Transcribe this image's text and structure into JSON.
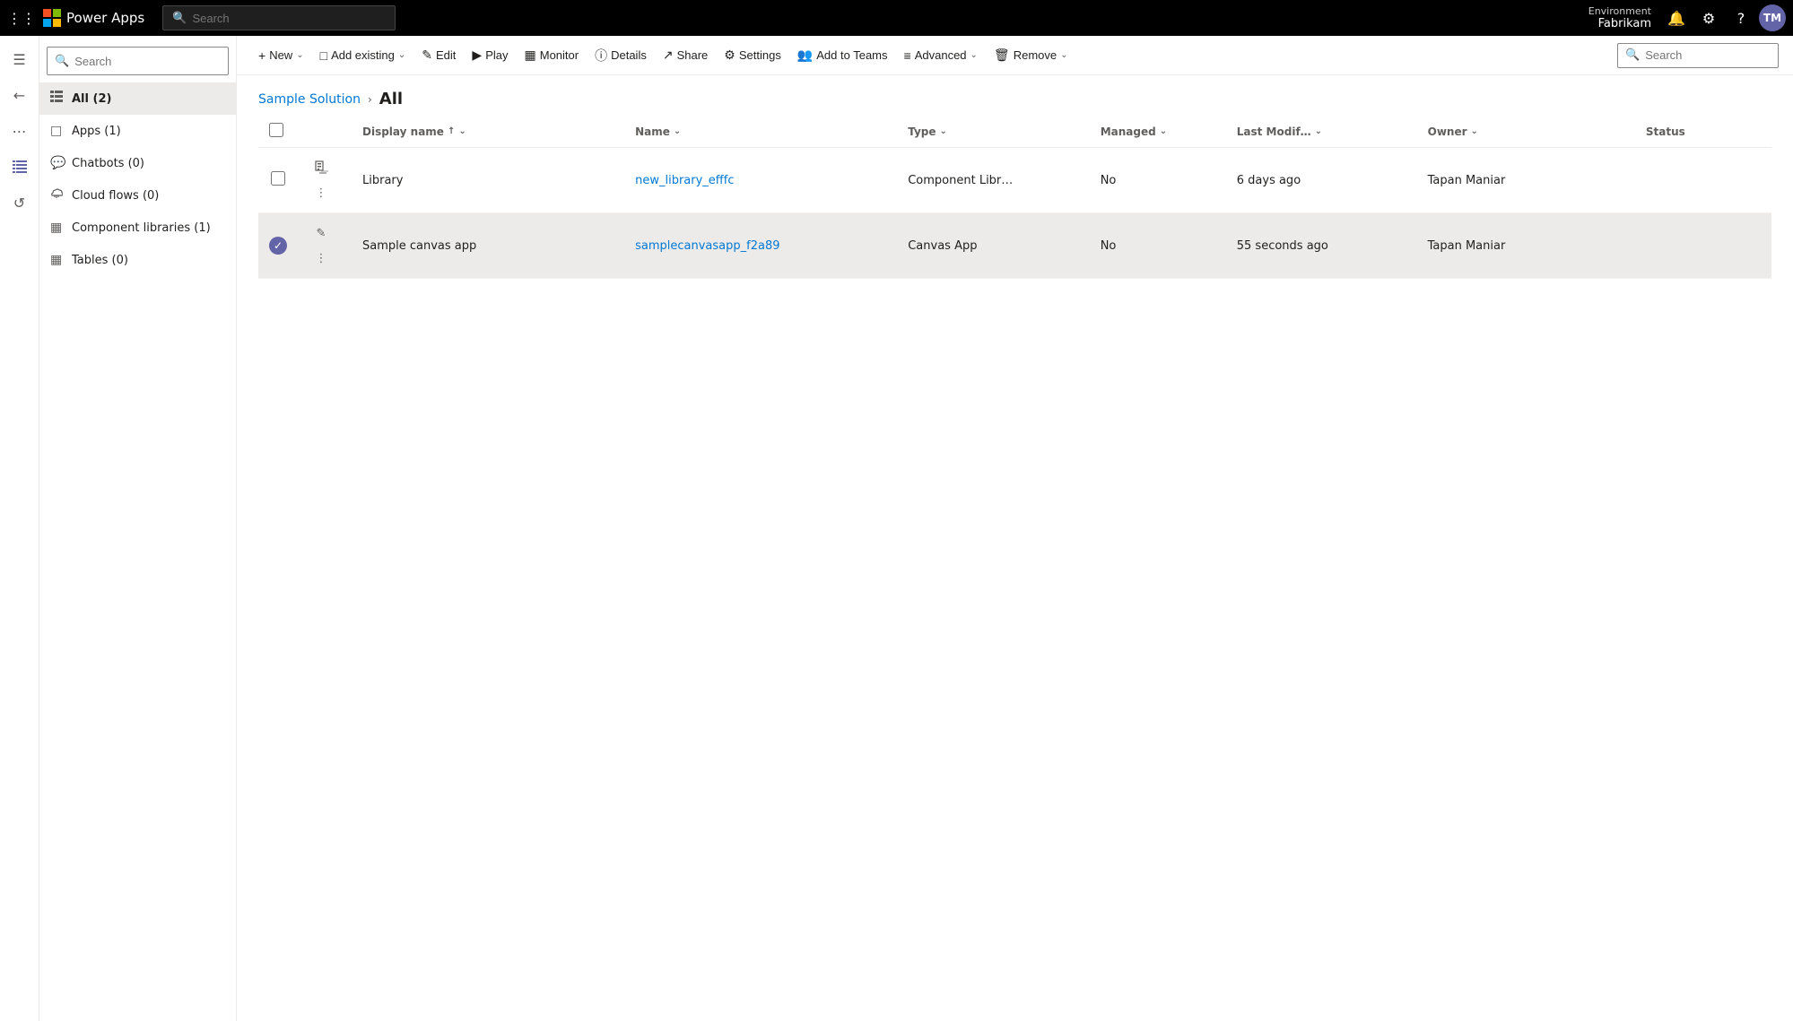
{
  "topbar": {
    "waffle_label": "⊞",
    "app_name": "Power Apps",
    "search_placeholder": "Search",
    "env_label": "Environment",
    "env_name": "Fabrikam",
    "avatar_initials": "TM"
  },
  "rail": {
    "items": [
      {
        "icon": "☰",
        "label": "menu-icon",
        "active": false
      },
      {
        "icon": "←",
        "label": "back-icon",
        "active": false
      },
      {
        "icon": "…",
        "label": "more-icon",
        "active": false
      },
      {
        "icon": "🏠",
        "label": "home-icon",
        "active": false
      },
      {
        "icon": "≡",
        "label": "list-icon",
        "active": true
      },
      {
        "icon": "↺",
        "label": "history-icon",
        "active": false
      }
    ]
  },
  "sidebar": {
    "search_placeholder": "Search",
    "items": [
      {
        "label": "All (2)",
        "icon": "≡≡",
        "active": true,
        "count": 2
      },
      {
        "label": "Apps (1)",
        "icon": "⊞",
        "active": false,
        "count": 1
      },
      {
        "label": "Chatbots (0)",
        "icon": "💬",
        "active": false,
        "count": 0
      },
      {
        "label": "Cloud flows (0)",
        "icon": "~",
        "active": false,
        "count": 0
      },
      {
        "label": "Component libraries (1)",
        "icon": "⊟",
        "active": false,
        "count": 1
      },
      {
        "label": "Tables (0)",
        "icon": "⊞",
        "active": false,
        "count": 0
      }
    ]
  },
  "commandbar": {
    "buttons": [
      {
        "label": "New",
        "icon": "+",
        "has_caret": true
      },
      {
        "label": "Add existing",
        "icon": "⊞",
        "has_caret": true
      },
      {
        "label": "Edit",
        "icon": "✏",
        "has_caret": false
      },
      {
        "label": "Play",
        "icon": "▶",
        "has_caret": false
      },
      {
        "label": "Monitor",
        "icon": "⊟",
        "has_caret": false
      },
      {
        "label": "Details",
        "icon": "ℹ",
        "has_caret": false
      },
      {
        "label": "Share",
        "icon": "↗",
        "has_caret": false
      },
      {
        "label": "Settings",
        "icon": "⚙",
        "has_caret": false
      },
      {
        "label": "Add to Teams",
        "icon": "👥",
        "has_caret": false
      },
      {
        "label": "Advanced",
        "icon": "≡",
        "has_caret": true
      },
      {
        "label": "Remove",
        "icon": "🗑",
        "has_caret": true
      }
    ],
    "search_placeholder": "Search"
  },
  "breadcrumb": {
    "parent_label": "Sample Solution",
    "separator": ">",
    "current_label": "All"
  },
  "table": {
    "columns": [
      {
        "label": "Display name",
        "sort": "asc",
        "has_filter": true
      },
      {
        "label": "Name",
        "sort": "none",
        "has_filter": true
      },
      {
        "label": "Type",
        "sort": "none",
        "has_filter": true
      },
      {
        "label": "Managed",
        "sort": "none",
        "has_filter": true
      },
      {
        "label": "Last Modif…",
        "sort": "none",
        "has_filter": true
      },
      {
        "label": "Owner",
        "sort": "none",
        "has_filter": true
      },
      {
        "label": "Status",
        "sort": "none",
        "has_filter": false
      }
    ],
    "rows": [
      {
        "display_name": "Library",
        "name": "new_library_efffc",
        "type": "Component Libr…",
        "managed": "No",
        "last_modified": "6 days ago",
        "owner": "Tapan Maniar",
        "status": "",
        "selected": false,
        "edit_icon": false
      },
      {
        "display_name": "Sample canvas app",
        "name": "samplecanvasapp_f2a89",
        "type": "Canvas App",
        "managed": "No",
        "last_modified": "55 seconds ago",
        "owner": "Tapan Maniar",
        "status": "",
        "selected": true,
        "edit_icon": true
      }
    ]
  }
}
